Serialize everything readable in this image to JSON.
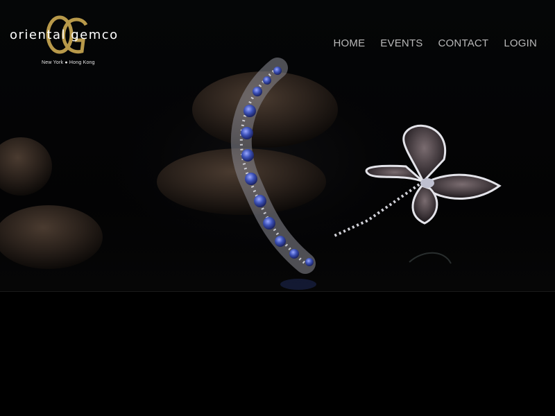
{
  "brand": {
    "wordmark": "oriental gemco",
    "monogram": "OG",
    "tagline": "New York ● Hong Kong",
    "gold": "#b8994a"
  },
  "nav": {
    "items": [
      {
        "label": "HOME"
      },
      {
        "label": "EVENTS"
      },
      {
        "label": "CONTACT"
      },
      {
        "label": "LOGIN"
      }
    ]
  },
  "hero": {
    "image": "jewelry-bracelet-and-butterfly-brooch",
    "sapphire_color": "#3d52b8",
    "background": "#000000"
  }
}
